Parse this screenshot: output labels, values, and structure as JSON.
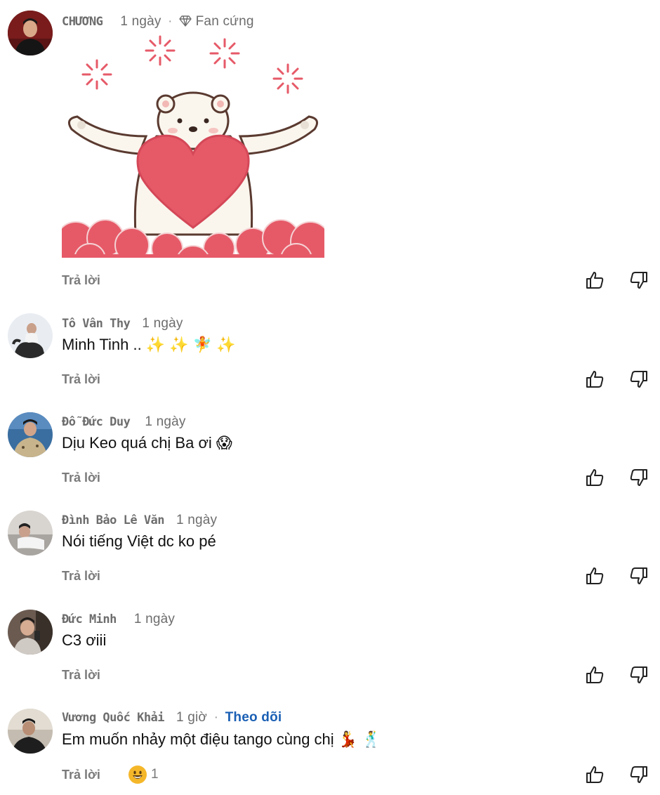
{
  "comments": [
    {
      "author": "CHƯƠNG",
      "time": "1 ngày",
      "badge": "Fan cứng",
      "text": "",
      "reply_label": "Trả lời",
      "has_sticker": true
    },
    {
      "author": "Tô Vân Thy",
      "time": "1 ngày",
      "text": "Minh Tinh .. ✨ ✨ 🧚 ✨",
      "reply_label": "Trả lời"
    },
    {
      "author": "Đỗ Đức Duy",
      "time": "1 ngày",
      "text": "Dịu Keo quá chị Ba ơi 😱",
      "reply_label": "Trả lời"
    },
    {
      "author": "Đình Bảo Lê Văn",
      "time": "1 ngày",
      "text": "Nói tiếng Việt dc ko pé",
      "reply_label": "Trả lời"
    },
    {
      "author": "Đức Minh",
      "time": "1 ngày",
      "text": "C3 ơiii",
      "reply_label": "Trả lời"
    },
    {
      "author": "Vương Quốc Khải",
      "time": "1 giờ",
      "follow_label": "Theo dõi",
      "text": "Em muốn nhảy một điệu tango cùng chị 💃 🕺",
      "reply_label": "Trả lời",
      "reaction_count": "1"
    }
  ],
  "colors": {
    "link_blue": "#1a5fb4",
    "muted_text": "#6d6d6d",
    "sticker_red": "#e65a68"
  },
  "icons": {
    "like": "thumbs-up-icon",
    "dislike": "thumbs-down-icon",
    "badge": "diamond-icon",
    "reaction": "grinning-face-icon"
  }
}
